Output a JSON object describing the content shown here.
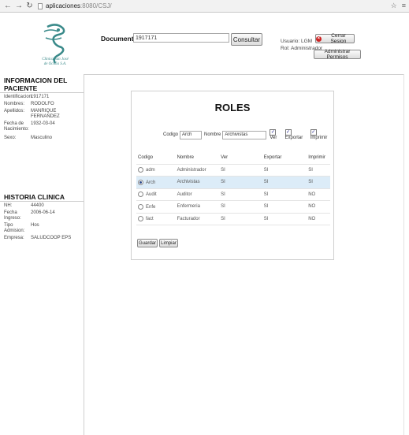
{
  "browser": {
    "url_host": "aplicaciones",
    "url_path": ":8080/CSJ/"
  },
  "header": {
    "logo_text_line1": "Clinica San José",
    "logo_text_line2": "de Ocaña S.A.",
    "documento_label": "Documento:",
    "documento_value": "1917171",
    "consultar_label": "Consultar",
    "usuario": "Usuario: LGM",
    "rol": "Rol: Administrador",
    "cerrar_label": "Cerrar Sesion",
    "permisos_label": "Administrar Permisos",
    "icon_colors": {
      "close": "#cc2222",
      "logo": "#3a8a8a"
    }
  },
  "paciente": {
    "title": "INFORMACION DEL PACIENTE",
    "fields": [
      {
        "label": "Identificacion:",
        "value": "1917171"
      },
      {
        "label": "Nombres:",
        "value": "RODOLFO"
      },
      {
        "label": "Apellidos:",
        "value": "MANRIQUE FERNANDEZ"
      },
      {
        "label": "Fecha de Nacimiento:",
        "value": "1932-03-04"
      },
      {
        "label": "Sexo:",
        "value": "Masculino"
      }
    ]
  },
  "historia": {
    "title": "HISTORIA CLINICA",
    "fields": [
      {
        "label": "NH:",
        "value": "44400"
      },
      {
        "label": "Fecha Ingreso:",
        "value": "2006-06-14"
      },
      {
        "label": "Tipo Admision:",
        "value": "Hos"
      },
      {
        "label": "Empresa:",
        "value": "SALUDCOOP EPS"
      }
    ]
  },
  "roles": {
    "title": "ROLES",
    "codigo_label": "Codigo",
    "codigo_value": "Arch",
    "nombre_label": "Nombre",
    "nombre_value": "Archivistas",
    "ver_label": "Ver",
    "exportar_label": "Exportar",
    "imprimir_label": "Imprimir",
    "columns": [
      "Codigo",
      "Nombre",
      "Ver",
      "Exportar",
      "Imprimir"
    ],
    "rows": [
      {
        "codigo": "adm",
        "nombre": "Administrador",
        "ver": "SI",
        "exportar": "SI",
        "imprimir": "SI",
        "selected": false
      },
      {
        "codigo": "Arch",
        "nombre": "Archivistas",
        "ver": "SI",
        "exportar": "SI",
        "imprimir": "SI",
        "selected": true
      },
      {
        "codigo": "Audit",
        "nombre": "Auditor",
        "ver": "SI",
        "exportar": "SI",
        "imprimir": "NO",
        "selected": false
      },
      {
        "codigo": "Enfe",
        "nombre": "Enfermeria",
        "ver": "SI",
        "exportar": "SI",
        "imprimir": "NO",
        "selected": false
      },
      {
        "codigo": "fact",
        "nombre": "Facturador",
        "ver": "SI",
        "exportar": "SI",
        "imprimir": "NO",
        "selected": false
      }
    ],
    "guardar_label": "Guardar",
    "limpiar_label": "Limpiar",
    "selected_row_color": "#dcecf8"
  }
}
